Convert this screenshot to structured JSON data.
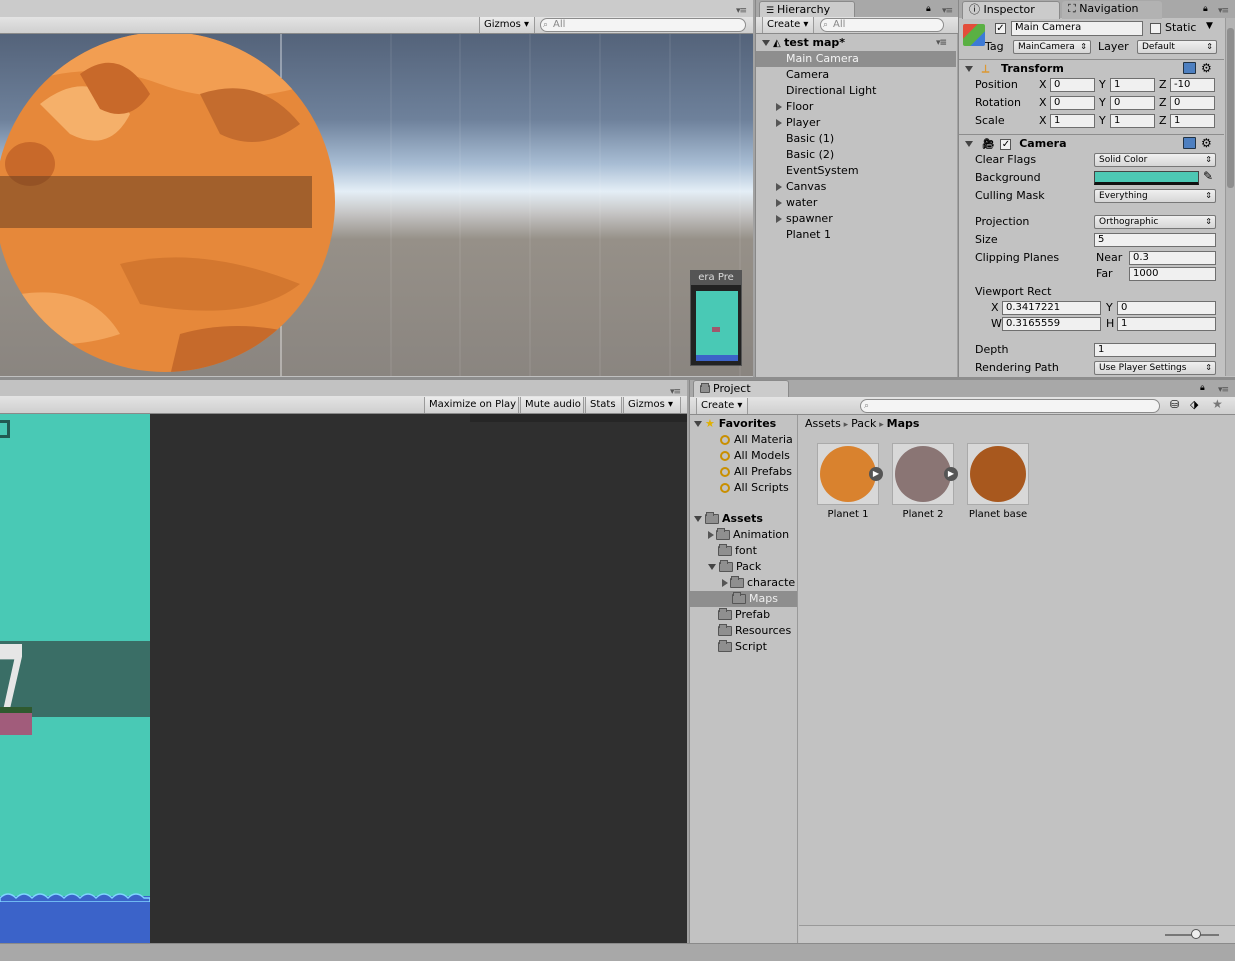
{
  "scene": {
    "gizmos_label": "Gizmos",
    "search_placeholder": "All",
    "camera_preview_title": "era Pre"
  },
  "game": {
    "maximize_label": "Maximize on Play",
    "mute_label": "Mute audio",
    "stats_label": "Stats",
    "gizmos_label": "Gizmos"
  },
  "hierarchy": {
    "tab_label": "Hierarchy",
    "create_label": "Create",
    "search_placeholder": "All",
    "scene_name": "test map*",
    "items": [
      {
        "label": "Main Camera",
        "expandable": false,
        "selected": true
      },
      {
        "label": "Camera",
        "expandable": false,
        "selected": false
      },
      {
        "label": "Directional Light",
        "expandable": false,
        "selected": false
      },
      {
        "label": "Floor",
        "expandable": true,
        "selected": false
      },
      {
        "label": "Player",
        "expandable": true,
        "selected": false
      },
      {
        "label": "Basic (1)",
        "expandable": false,
        "selected": false
      },
      {
        "label": "Basic (2)",
        "expandable": false,
        "selected": false
      },
      {
        "label": "EventSystem",
        "expandable": false,
        "selected": false
      },
      {
        "label": "Canvas",
        "expandable": true,
        "selected": false
      },
      {
        "label": "water",
        "expandable": true,
        "selected": false
      },
      {
        "label": "spawner",
        "expandable": true,
        "selected": false
      },
      {
        "label": "Planet 1",
        "expandable": false,
        "selected": false
      }
    ]
  },
  "inspector": {
    "tab_label": "Inspector",
    "nav_tab_label": "Navigation",
    "object_name": "Main Camera",
    "static_label": "Static",
    "tag_label": "Tag",
    "tag_value": "MainCamera",
    "layer_label": "Layer",
    "layer_value": "Default",
    "transform": {
      "title": "Transform",
      "position_label": "Position",
      "rotation_label": "Rotation",
      "scale_label": "Scale",
      "x_label": "X",
      "y_label": "Y",
      "z_label": "Z",
      "position": {
        "x": "0",
        "y": "1",
        "z": "-10"
      },
      "rotation": {
        "x": "0",
        "y": "0",
        "z": "0"
      },
      "scale": {
        "x": "1",
        "y": "1",
        "z": "1"
      }
    },
    "camera": {
      "title": "Camera",
      "clear_flags_label": "Clear Flags",
      "clear_flags_value": "Solid Color",
      "background_label": "Background",
      "background_color": "#4dc8b4",
      "culling_label": "Culling Mask",
      "culling_value": "Everything",
      "projection_label": "Projection",
      "projection_value": "Orthographic",
      "size_label": "Size",
      "size_value": "5",
      "clipping_label": "Clipping Planes",
      "near_label": "Near",
      "near_value": "0.3",
      "far_label": "Far",
      "far_value": "1000",
      "viewport_label": "Viewport Rect",
      "vx_label": "X",
      "vx_value": "0.3417221",
      "vy_label": "Y",
      "vy_value": "0",
      "vw_label": "W",
      "vw_value": "0.3165559",
      "vh_label": "H",
      "vh_value": "1",
      "depth_label": "Depth",
      "depth_value": "1",
      "rendering_label": "Rendering Path",
      "rendering_value": "Use Player Settings"
    }
  },
  "project": {
    "tab_label": "Project",
    "create_label": "Create",
    "favorites_label": "Favorites",
    "favorites": [
      "All Materia",
      "All Models",
      "All Prefabs",
      "All Scripts"
    ],
    "assets_label": "Assets",
    "folders": [
      {
        "label": "Animation",
        "expandable": true,
        "indent": 1,
        "selected": false
      },
      {
        "label": "font",
        "expandable": false,
        "indent": 1,
        "selected": false
      },
      {
        "label": "Pack",
        "expandable": true,
        "indent": 1,
        "selected": false
      },
      {
        "label": "characte",
        "expandable": true,
        "indent": 2,
        "selected": false
      },
      {
        "label": "Maps",
        "expandable": false,
        "indent": 2,
        "selected": true
      },
      {
        "label": "Prefab",
        "expandable": false,
        "indent": 1,
        "selected": false
      },
      {
        "label": "Resources",
        "expandable": false,
        "indent": 1,
        "selected": false
      },
      {
        "label": "Script",
        "expandable": false,
        "indent": 1,
        "selected": false
      }
    ],
    "breadcrumb": [
      "Assets",
      "Pack",
      "Maps"
    ],
    "assets": [
      {
        "label": "Planet 1",
        "color": "#d9822e"
      },
      {
        "label": "Planet 2",
        "color": "#8a7574"
      },
      {
        "label": "Planet base",
        "color": "#a8581e"
      }
    ]
  }
}
